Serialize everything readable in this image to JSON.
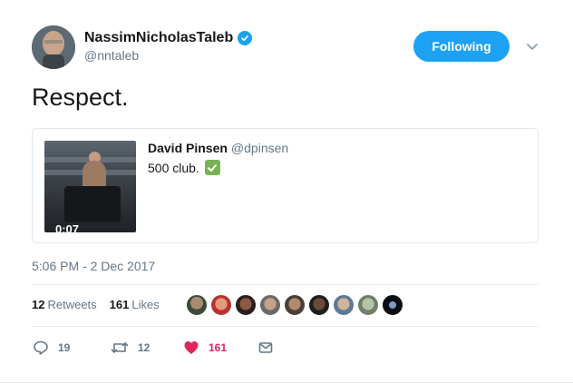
{
  "author": {
    "name": "NassimNicholasTaleb",
    "handle": "@nntaleb",
    "verified_icon": "verified-badge-icon",
    "follow_label": "Following"
  },
  "tweet": {
    "text": "Respect."
  },
  "quoted": {
    "name": "David Pinsen",
    "handle": "@dpinsen",
    "text": "500 club.",
    "emoji": "check-mark-button-icon",
    "video_duration": "0:07"
  },
  "timestamp": "5:06 PM - 2 Dec 2017",
  "stats": {
    "retweets_count": "12",
    "retweets_label": "Retweets",
    "likes_count": "161",
    "likes_label": "Likes"
  },
  "actions": {
    "reply_count": "19",
    "retweet_count": "12",
    "like_count": "161"
  },
  "colors": {
    "accent": "#1da1f2",
    "like": "#e0245e",
    "muted": "#657786",
    "check_green": "#77b255"
  }
}
